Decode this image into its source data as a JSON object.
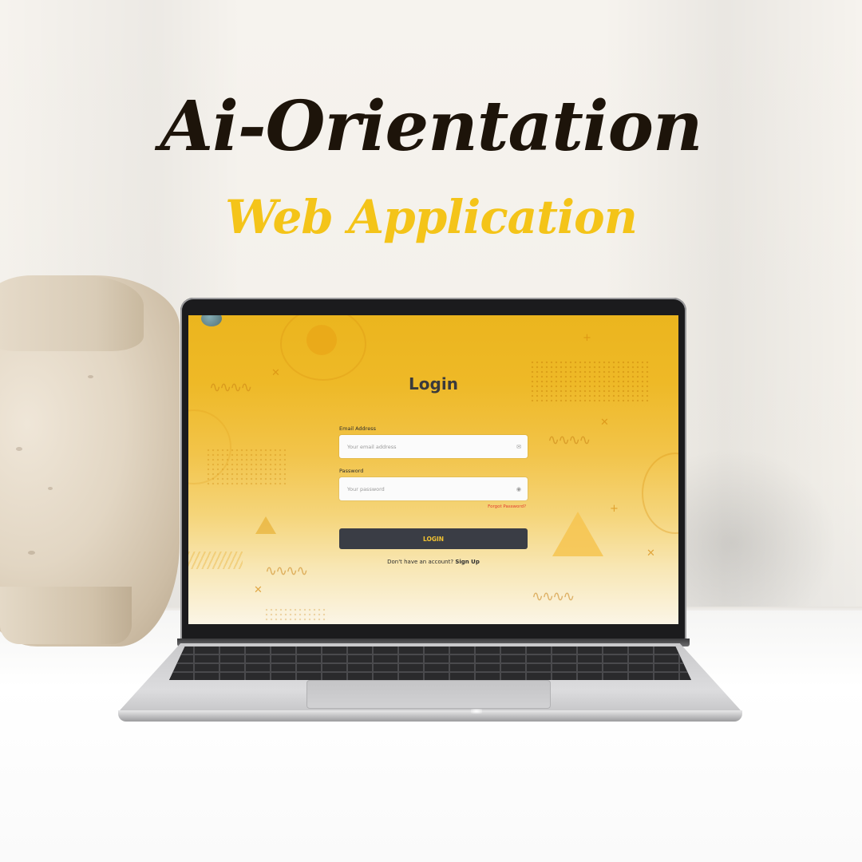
{
  "hero": {
    "title": "Ai-Orientation",
    "subtitle": "Web Application"
  },
  "login": {
    "title": "Login",
    "email": {
      "label": "Email Address",
      "placeholder": "Your email address",
      "icon": "envelope-icon"
    },
    "password": {
      "label": "Password",
      "placeholder": "Your password",
      "icon": "eye-icon"
    },
    "forgot_link": "Forgot Password?",
    "submit_label": "LOGIN",
    "signup_prompt": "Don't have an account?",
    "signup_link": "Sign Up"
  },
  "colors": {
    "accent_yellow": "#f4c419",
    "title_dark": "#1d140a",
    "button_bg": "#3a3d45",
    "button_text": "#f1c232",
    "link_red": "#e23a2f"
  }
}
